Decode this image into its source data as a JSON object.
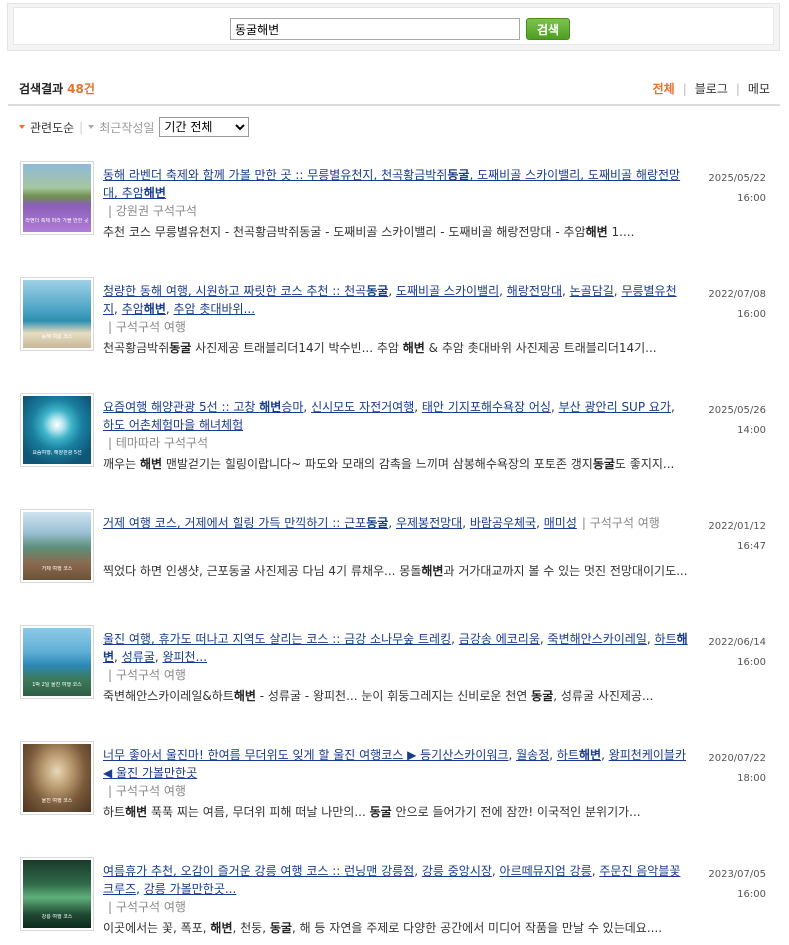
{
  "search": {
    "query": "동굴해변",
    "button_label": "검색"
  },
  "result_header": {
    "title": "검색결과",
    "count": "48건",
    "tabs": [
      "전체",
      "블로그",
      "메모"
    ],
    "active_tab": "전체"
  },
  "sort": {
    "relevance": "관련도순",
    "recent": "최근작성일",
    "period_selected": "기간 전체"
  },
  "colors": {
    "accent": "#e8722a",
    "link": "#1a3c8c",
    "button_green": "#5aab2a"
  },
  "results": [
    {
      "title": "동해 라벤더 축제와 함께 가볼 만한 곳 :: 무릉별유천지, 천곡황금박쥐동굴, 도째비골 스카이밸리, 도째비골 해랑전망대, 추암해변",
      "meta": "| 강원권 구석구석",
      "date": "2025/05/22 16:00",
      "snippet": "추천 코스 무릉별유천지 - 천곡황금박쥐동굴 - 도째비골 스카이밸리 - 도째비골 해랑전망대 - 추암해변 1....",
      "thumb_caption": "라벤더 축제 따라 가볼 만한 곳"
    },
    {
      "title": "청량한 동해 여행, 시원하고 짜릿한 코스 추천 :: 천곡동굴, 도째비골 스카이밸리, 해랑전망대, 논골담길, 무릉별유천지, 추암해변, 추암 촛대바위...",
      "meta": "| 구석구석 여행",
      "date": "2022/07/08 16:00",
      "snippet": "천곡황금박쥐동굴 사진제공 트래블리더14기 박수빈... 추암 해변 & 추암 촛대바위 사진제공 트래블리더14기...",
      "thumb_caption": "동해 여름 코스"
    },
    {
      "title": "요즘여행 해양관광 5선 :: 고창 해변승마, 신시모도 자전거여행, 태안 기지포해수욕장 어싱, 부산 광안리 SUP 요가, 하도 어촌체험마을 해녀체험",
      "meta": "| 테마따라 구석구석",
      "date": "2025/05/26 14:00",
      "snippet": "깨우는 해변 맨발걷기는 힐링이랍니다~ 파도와 모래의 감촉을 느끼며 삼봉해수욕장의 포토존 갱지동굴도 좋지지...",
      "thumb_caption": "요즘여행, 해양관광 5선"
    },
    {
      "title": "거제 여행 코스, 거제에서 힐링 가득 만끽하기 :: 근포동굴, 우제봉전망대, 바람공우체국, 매미성",
      "meta": "| 구석구석 여행",
      "date": "2022/01/12 16:47",
      "snippet": "찍었다 하면 인생샷, 근포동굴 사진제공 다님 4기 류채우... 몽돌해변과 거가대교까지 볼 수 있는 멋진 전망대이기도...",
      "thumb_caption": "거제 여행 코스"
    },
    {
      "title": "울진 여행, 휴가도 떠나고 지역도 살리는 코스 :: 금강 소나무숲 트레킹, 금강송 에코리움, 죽변해안스카이레일, 하트해변, 성류굴, 왕피천...",
      "meta": "| 구석구석 여행",
      "date": "2022/06/14 16:00",
      "snippet": "죽변해안스카이레일&하트해변 - 성류굴 - 왕피천... 눈이 휘둥그레지는 신비로운 천연 동굴, 성류굴 사진제공...",
      "thumb_caption": "1박 2일 울진 여행 코스"
    },
    {
      "title": "너무 좋아서 울진마! 한여름 무더위도 잊게 할 울진 여행코스 ▶ 등기산스카이워크, 월송정, 하트해변, 왕피천케이블카◀ 울진 가볼만한곳",
      "meta": "| 구석구석 여행",
      "date": "2020/07/22 18:00",
      "snippet": "하트해변 푹푹 찌는 여름, 무더위 피해 떠날 나만의... 동굴 안으로 들어가기 전에 잠깐! 이국적인 분위기가...",
      "thumb_caption": "울진 여행 코스"
    },
    {
      "title": "여름휴가 추천, 오감이 즐거운 강릉 여행 코스 :: 런닝맨 강릉점, 강릉 중앙시장, 아르떼뮤지엄 강릉, 주문진 음악블꽃 크루즈, 강릉 가볼만한곳...",
      "meta": "| 구석구석 여행",
      "date": "2023/07/05 16:00",
      "snippet": "이곳에서는 꽃, 폭포, 해변, 천둥, 동굴, 해 등 자연을 주제로 다양한 공간에서 미디어 작품을 만날 수 있는데요....",
      "thumb_caption": "강릉 여행 코스"
    }
  ]
}
